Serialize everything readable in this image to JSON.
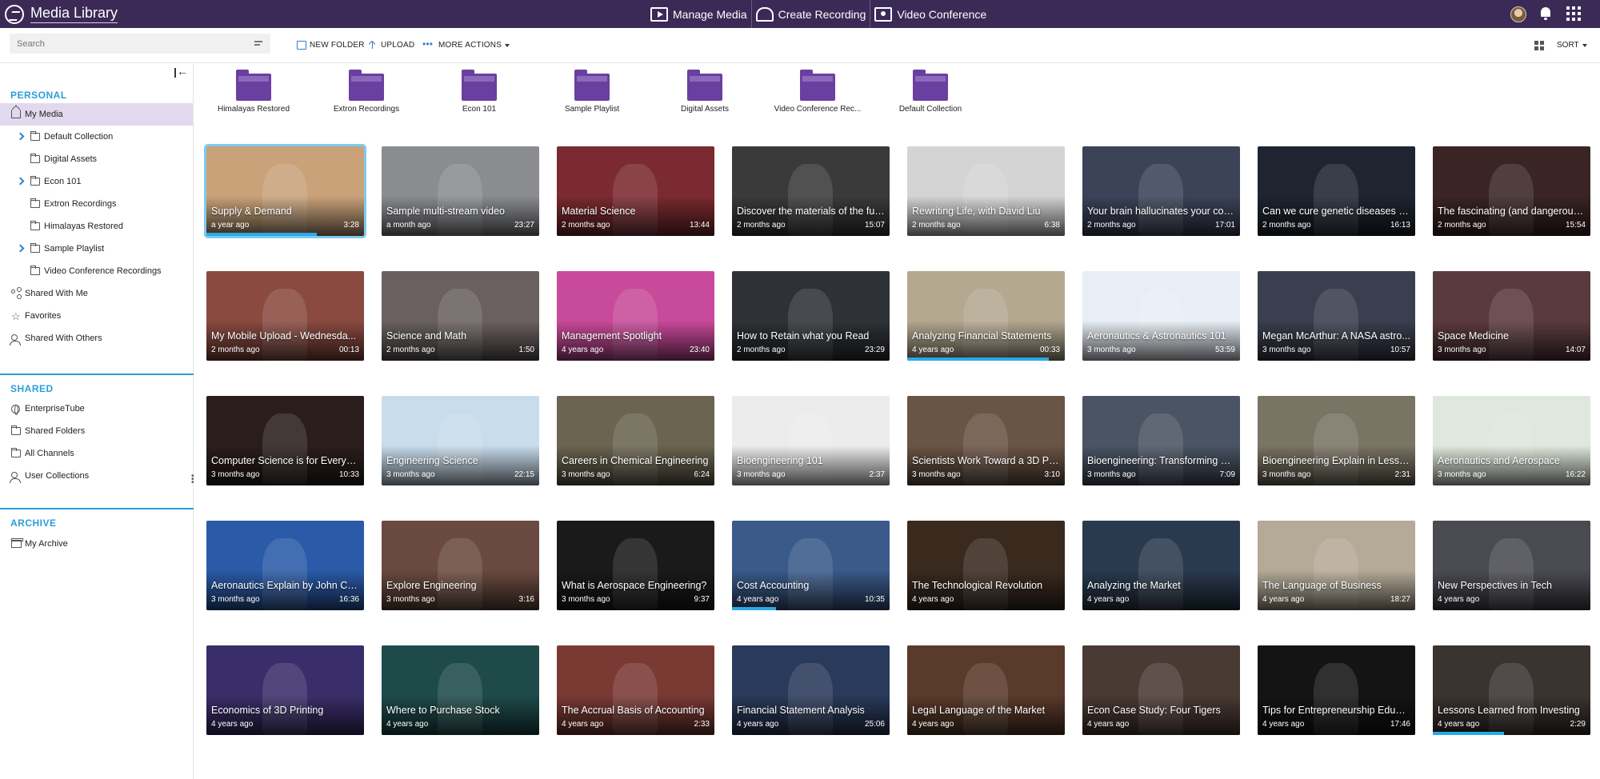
{
  "app": {
    "title": "Media Library"
  },
  "topnav": [
    {
      "label": "Manage Media",
      "icon": "media-icon"
    },
    {
      "label": "Create Recording",
      "icon": "recording-icon"
    },
    {
      "label": "Video Conference",
      "icon": "video-conference-icon"
    }
  ],
  "toolbar": {
    "search_placeholder": "Search",
    "new_folder": "NEW FOLDER",
    "upload": "UPLOAD",
    "more_actions": "MORE ACTIONS",
    "sort": "SORT"
  },
  "sidebar": {
    "personal_header": "PERSONAL",
    "personal_items": [
      {
        "label": "My Media",
        "icon": "home-icon",
        "active": true
      },
      {
        "label": "Default Collection",
        "icon": "folder-icon",
        "expandable": true
      },
      {
        "label": "Digital Assets",
        "icon": "folder-icon"
      },
      {
        "label": "Econ 101",
        "icon": "folder-icon",
        "expandable": true
      },
      {
        "label": "Extron Recordings",
        "icon": "folder-icon"
      },
      {
        "label": "Himalayas Restored",
        "icon": "folder-icon"
      },
      {
        "label": "Sample Playlist",
        "icon": "folder-icon",
        "expandable": true
      },
      {
        "label": "Video Conference Recordings",
        "icon": "folder-icon"
      },
      {
        "label": "Shared With Me",
        "icon": "share-icon"
      },
      {
        "label": "Favorites",
        "icon": "star-icon"
      },
      {
        "label": "Shared With Others",
        "icon": "user-share-icon"
      }
    ],
    "shared_header": "SHARED",
    "shared_items": [
      {
        "label": "EnterpriseTube",
        "icon": "globe-icon"
      },
      {
        "label": "Shared Folders",
        "icon": "folder-icon"
      },
      {
        "label": "All Channels",
        "icon": "channels-icon"
      },
      {
        "label": "User Collections",
        "icon": "user-icon"
      }
    ],
    "archive_header": "ARCHIVE",
    "archive_items": [
      {
        "label": "My Archive",
        "icon": "archive-icon"
      }
    ]
  },
  "folders": [
    "Himalayas Restored",
    "Extron Recordings",
    "Econ 101",
    "Sample Playlist",
    "Digital Assets",
    "Video Conference Rec...",
    "Default Collection"
  ],
  "videos": [
    {
      "title": "Supply & Demand",
      "age": "a year ago",
      "duration": "3:28",
      "progress": 0.7,
      "bg": "#c9a27a"
    },
    {
      "title": "Sample multi-stream video",
      "age": "a month ago",
      "duration": "23:27",
      "bg": "#8a8c90"
    },
    {
      "title": "Material Science",
      "age": "2 months ago",
      "duration": "13:44",
      "bg": "#7a2a30"
    },
    {
      "title": "Discover the materials of the fut...",
      "age": "2 months ago",
      "duration": "15:07",
      "bg": "#3a3a3a"
    },
    {
      "title": "Rewriting Life, with David Liu",
      "age": "2 months ago",
      "duration": "6:38",
      "bg": "#d4d4d4"
    },
    {
      "title": "Your brain hallucinates your con...",
      "age": "2 months ago",
      "duration": "17:01",
      "bg": "#3c4258"
    },
    {
      "title": "Can we cure genetic diseases b...",
      "age": "2 months ago",
      "duration": "16:13",
      "bg": "#1e2430"
    },
    {
      "title": "The fascinating (and dangerous)...",
      "age": "2 months ago",
      "duration": "15:54",
      "bg": "#3a2424"
    },
    {
      "title": "My Mobile Upload - Wednesda...",
      "age": "2 months ago",
      "duration": "00:13",
      "bg": "#8a4a40"
    },
    {
      "title": "Science and Math",
      "age": "2 months ago",
      "duration": "1:50",
      "bg": "#6a6060"
    },
    {
      "title": "Management Spotlight",
      "age": "4 years ago",
      "duration": "23:40",
      "bg": "#c84a9a"
    },
    {
      "title": "How to Retain what you Read",
      "age": "2 months ago",
      "duration": "23:29",
      "bg": "#2e3236"
    },
    {
      "title": "Analyzing Financial Statements",
      "age": "4 years ago",
      "duration": "00:33",
      "progress": 0.9,
      "bg": "#b4a890"
    },
    {
      "title": "Aeronautics & Astronautics 101",
      "age": "3 months ago",
      "duration": "53:59",
      "bg": "#e8eef6"
    },
    {
      "title": "Megan McArthur: A NASA astro...",
      "age": "3 months ago",
      "duration": "10:57",
      "bg": "#3a3e4e"
    },
    {
      "title": "Space Medicine",
      "age": "3 months ago",
      "duration": "14:07",
      "bg": "#5a3a3e"
    },
    {
      "title": "Computer Science is for Everyo...",
      "age": "3 months ago",
      "duration": "10:33",
      "bg": "#2a1e1c"
    },
    {
      "title": "Engineering Science",
      "age": "3 months ago",
      "duration": "22:15",
      "bg": "#c8dcec"
    },
    {
      "title": "Careers in Chemical Engineering",
      "age": "3 months ago",
      "duration": "6:24",
      "bg": "#6a6450"
    },
    {
      "title": "Bioengineering 101",
      "age": "3 months ago",
      "duration": "2:37",
      "bg": "#ececec"
    },
    {
      "title": "Scientists Work Toward a 3D Pri...",
      "age": "3 months ago",
      "duration": "3:10",
      "bg": "#6a5444"
    },
    {
      "title": "Bioengineering: Transforming H...",
      "age": "3 months ago",
      "duration": "7:09",
      "bg": "#4a5464"
    },
    {
      "title": "Bioengineering Explain in Less t...",
      "age": "3 months ago",
      "duration": "2:31",
      "bg": "#7a7464"
    },
    {
      "title": "Aeronautics and Aerospace",
      "age": "3 months ago",
      "duration": "16:22",
      "bg": "#dfe8dc"
    },
    {
      "title": "Aeronautics Explain by John Coll...",
      "age": "3 months ago",
      "duration": "16:36",
      "bg": "#2a5aa8"
    },
    {
      "title": "Explore Engineering",
      "age": "3 months ago",
      "duration": "3:16",
      "bg": "#6a4a40"
    },
    {
      "title": "What is Aerospace Engineering?",
      "age": "3 months ago",
      "duration": "9:37",
      "bg": "#1a1a1a"
    },
    {
      "title": "Cost Accounting",
      "age": "4 years ago",
      "duration": "10:35",
      "progress": 0.28,
      "bg": "#3a5a8a"
    },
    {
      "title": "The Technological Revolution",
      "age": "4 years ago",
      "duration": "",
      "bg": "#3a2a1e"
    },
    {
      "title": "Analyzing the Market",
      "age": "4 years ago",
      "duration": "",
      "bg": "#2a3a4e"
    },
    {
      "title": "The Language of Business",
      "age": "4 years ago",
      "duration": "18:27",
      "bg": "#b4aa98"
    },
    {
      "title": "New Perspectives in Tech",
      "age": "4 years ago",
      "duration": "",
      "bg": "#4a4a52"
    },
    {
      "title": "Economics of 3D Printing",
      "age": "4 years ago",
      "duration": "",
      "bg": "#3a2e6a"
    },
    {
      "title": "Where to Purchase Stock",
      "age": "4 years ago",
      "duration": "",
      "bg": "#1e4a4a"
    },
    {
      "title": "The Accrual Basis of Accounting",
      "age": "4 years ago",
      "duration": "2:33",
      "bg": "#7a3a34"
    },
    {
      "title": "Financial Statement Analysis",
      "age": "4 years ago",
      "duration": "25:06",
      "bg": "#2a3a5a"
    },
    {
      "title": "Legal Language of the Market",
      "age": "4 years ago",
      "duration": "",
      "bg": "#5a3a2a"
    },
    {
      "title": "Econ Case Study: Four Tigers",
      "age": "4 years ago",
      "duration": "",
      "bg": "#4a3a34"
    },
    {
      "title": "Tips for Entrepreneurship Educat...",
      "age": "4 years ago",
      "duration": "17:46",
      "bg": "#141414"
    },
    {
      "title": "Lessons Learned from Investing",
      "age": "4 years ago",
      "duration": "2:29",
      "progress": 0.45,
      "bg": "#3a3430"
    }
  ]
}
